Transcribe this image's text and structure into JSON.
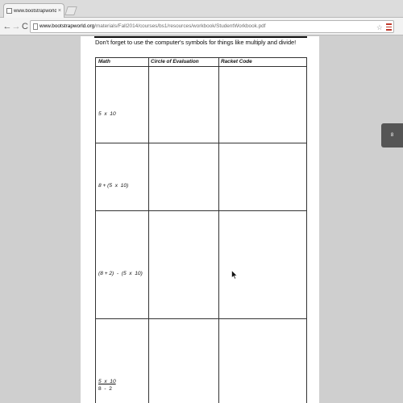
{
  "browser": {
    "tab": {
      "title": "www.bootstrapworld.org/m",
      "close_glyph": "×"
    },
    "nav": {
      "back_glyph": "←",
      "forward_glyph": "→",
      "reload_glyph": "C"
    },
    "address": {
      "host": "www.bootstrapworld.org",
      "path": "/materials/Fall2014/courses/bs1/resources/workbook/StudentWorkbook.pdf"
    },
    "star_glyph": "☆"
  },
  "pdf": {
    "instruction": "Don't forget to use the computer's symbols for things like multiply and divide!",
    "table": {
      "headers": [
        "Math",
        "Circle of Evaluation",
        "Racket Code"
      ],
      "rows": [
        {
          "math": "5  x  10"
        },
        {
          "math": "8 + (5  x  10)"
        },
        {
          "math": "(8 + 2)  -  (5  x  10)"
        },
        {
          "math_numerator": "5  x  10",
          "math_denominator": "8  -  2"
        }
      ]
    }
  },
  "side_button": {
    "label": "8"
  },
  "colors": {
    "viewer_bg": "#cfcfcf",
    "menu_accent": "#c0392b",
    "side_button": "#555555"
  }
}
